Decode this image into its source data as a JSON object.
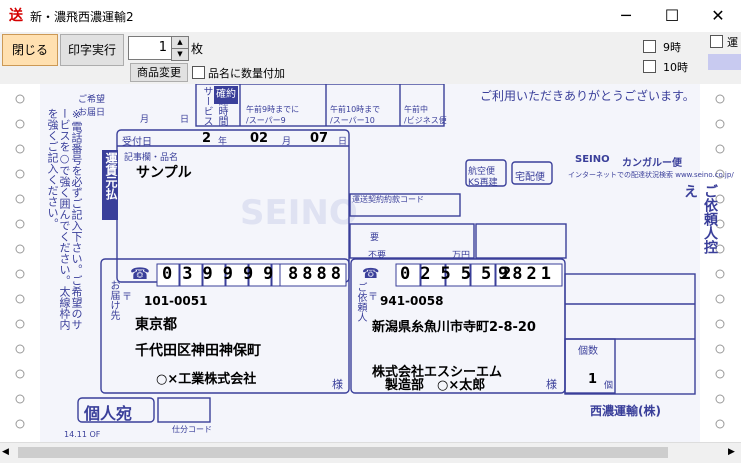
{
  "window": {
    "title": "新・濃飛西濃運輸2",
    "icon": "送",
    "controls": {
      "minimize": "─",
      "maximize": "☐",
      "close": "✕"
    }
  },
  "toolbar": {
    "close_label": "閉じる",
    "print_label": "印字実行",
    "copies_value": "1",
    "copies_unit": "枚",
    "product_change_label": "商品変更",
    "quantity_in_name_label": "品名に数量付加",
    "time9_label": "9時",
    "time10_label": "10時",
    "partial_label": "運"
  },
  "slip": {
    "kibou_date_label": "ご希望\nお届日",
    "month_label": "月",
    "day_label": "日",
    "reception_label": "受付日",
    "year": "2",
    "year_unit": "年",
    "month": "02",
    "month_unit": "月",
    "day": "07",
    "day_unit": "日",
    "item_label": "記事欄・品名",
    "item_name": "サンプル",
    "fare_label": "運賃元払",
    "service_label": "配達時間サービス",
    "kakunin_label": "確約",
    "gozen9_label": "午前9時までに\n/スーパー9",
    "gozen10_label": "午前10時まで\n/スーパー10",
    "gozenchu_label": "午前中\n/ビジネス便",
    "thanks_text": "ご利用いただきありがとうございます。",
    "tel_icon": "☎",
    "to_tel1": "039999",
    "to_tel2": "8888",
    "from_tel1": "025552",
    "from_tel2": "9821",
    "to_zip_icon": "〒",
    "to_zip": "101-0051",
    "to_pref": "東京都",
    "to_addr": "千代田区神田神保町",
    "to_name": "○×工業株式会社",
    "sama": "様",
    "from_zip": "941-0058",
    "from_addr": "新潟県糸魚川市寺町2-8-20",
    "from_company": "株式会社エスシーエム",
    "from_dept": "製造部　○×太郎",
    "to_side_label": "お届け先",
    "from_side_label": "ご依頼人",
    "side_note": "※電話番号を必ずご記入下さい。ご希望のサービスを○で強く囲んでください。太線枠内を強くご記入ください。",
    "count_label": "個数",
    "count_value": "1",
    "count_unit": "個",
    "kojin_label": "個人宛",
    "shiwake_label": "仕分コード",
    "seino_label": "SEINO",
    "kangaroo_label": "カンガルー便",
    "url_text": "インターネットでの配達状況検索 www.seino.co.jp/",
    "irainin_hikae": "ご依頼人控え",
    "company_footer": "西濃運輸(株)",
    "kaisoku_label": "航空便",
    "ks_label": "KS再建",
    "koutaku_label": "宅配便",
    "contract_label": "運送契約約款コード",
    "youfu_label": "要",
    "fuyou_label": "不要",
    "man_label": "万円",
    "version_text": "14.11 OF"
  },
  "colors": {
    "ink": "#3a3f9a",
    "paper_shadow": "#dfe2f2",
    "accent": "#ffe0b0"
  }
}
